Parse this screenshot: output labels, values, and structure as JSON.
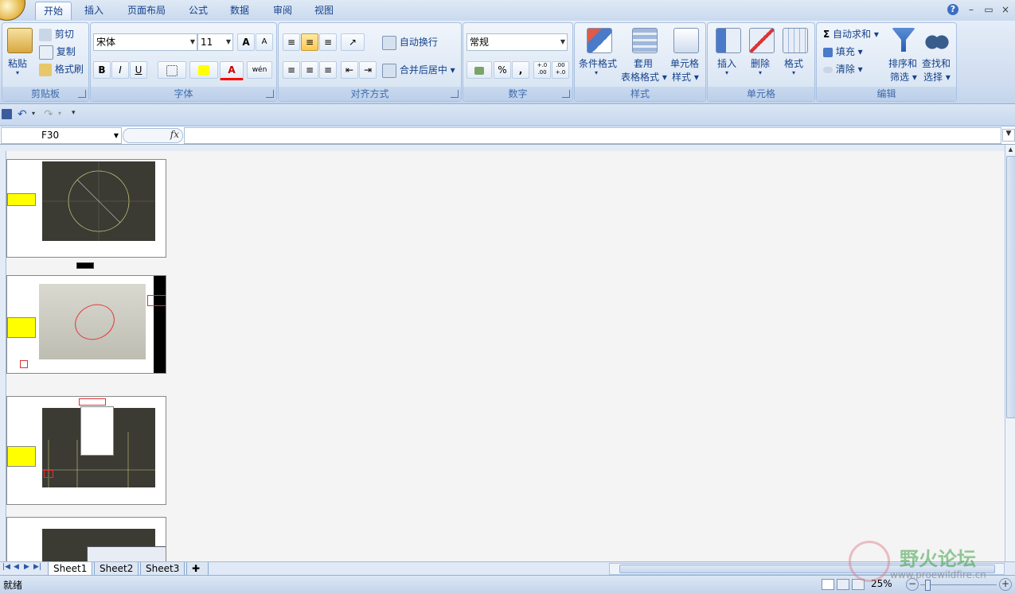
{
  "tabs": [
    "开始",
    "插入",
    "页面布局",
    "公式",
    "数据",
    "审阅",
    "视图"
  ],
  "window_controls": {
    "help": "?",
    "minimize": "–",
    "restore": "▭",
    "close": "×"
  },
  "clipboard": {
    "paste": "粘贴",
    "cut": "剪切",
    "copy": "复制",
    "format_painter": "格式刷",
    "group": "剪贴板"
  },
  "font": {
    "name": "宋体",
    "size": "11",
    "grow": "A",
    "shrink": "A",
    "bold": "B",
    "italic": "I",
    "underline": "U",
    "color_letter": "A",
    "wen": "wén",
    "group": "字体"
  },
  "alignment": {
    "wrap": "自动换行",
    "merge": "合并后居中",
    "group": "对齐方式"
  },
  "number": {
    "format": "常规",
    "percent": "%",
    "comma": ",",
    "inc": "+.0\n.00",
    "dec": ".00\n+.0",
    "group": "数字"
  },
  "styles": {
    "conditional": "条件格式",
    "table_a": "套用",
    "table_b": "表格格式",
    "cell_a": "单元格",
    "cell_b": "样式",
    "group": "样式"
  },
  "cells": {
    "insert": "插入",
    "delete": "删除",
    "format": "格式",
    "group": "单元格"
  },
  "editing": {
    "autosum": "自动求和",
    "fill": "填充",
    "clear": "清除",
    "sort_a": "排序和",
    "sort_b": "筛选",
    "find_a": "查找和",
    "find_b": "选择",
    "group": "编辑"
  },
  "name_box": "F30",
  "fx": "fx",
  "sheets": [
    "Sheet1",
    "Sheet2",
    "Sheet3"
  ],
  "status": {
    "ready": "就绪",
    "zoom": "25%"
  },
  "watermark": {
    "logo": "野火论坛",
    "url": "www.proewildfire.cn"
  },
  "colors": {
    "ribbon": "#dbe6f4",
    "accent": "#15428b",
    "note_yellow": "#ffff00"
  }
}
